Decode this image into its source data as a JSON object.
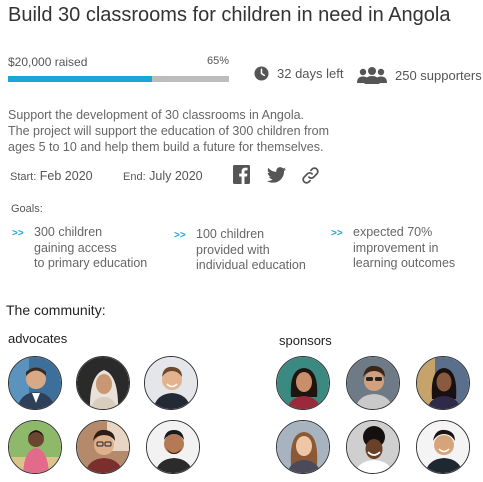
{
  "campaign": {
    "title": "Build 30 classrooms for children in need in Angola",
    "raised_label": "$20,000 raised",
    "progress_text": "65%",
    "progress": 0.65,
    "days_left": "32 days left",
    "supporters": "250 supporters",
    "description": [
      "Support the development of 30 classrooms in Angola.",
      "The project will support the education of 300 children from",
      "ages 5 to 10 and help them build a future for themselves."
    ],
    "start_label": "Start:",
    "start_value": "Feb 2020",
    "end_label": "End:",
    "end_value": "July 2020"
  },
  "social": {
    "icons": [
      "facebook-icon",
      "twitter-icon",
      "link-icon"
    ]
  },
  "goals": {
    "heading": "Goals:",
    "marker": ">>",
    "items": [
      [
        "300 children",
        "gaining access",
        "to primary education"
      ],
      [
        "100 children",
        "provided with",
        "individual education"
      ],
      [
        "expected 70%",
        "improvement in",
        "learning outcomes"
      ]
    ]
  },
  "community": {
    "heading": "The community:",
    "advocates_label": "advocates",
    "sponsors_label": "sponsors"
  },
  "colors": {
    "accent": "#1aa6d9",
    "track": "#bdbdbd",
    "icon": "#555555",
    "title": "#333333"
  }
}
